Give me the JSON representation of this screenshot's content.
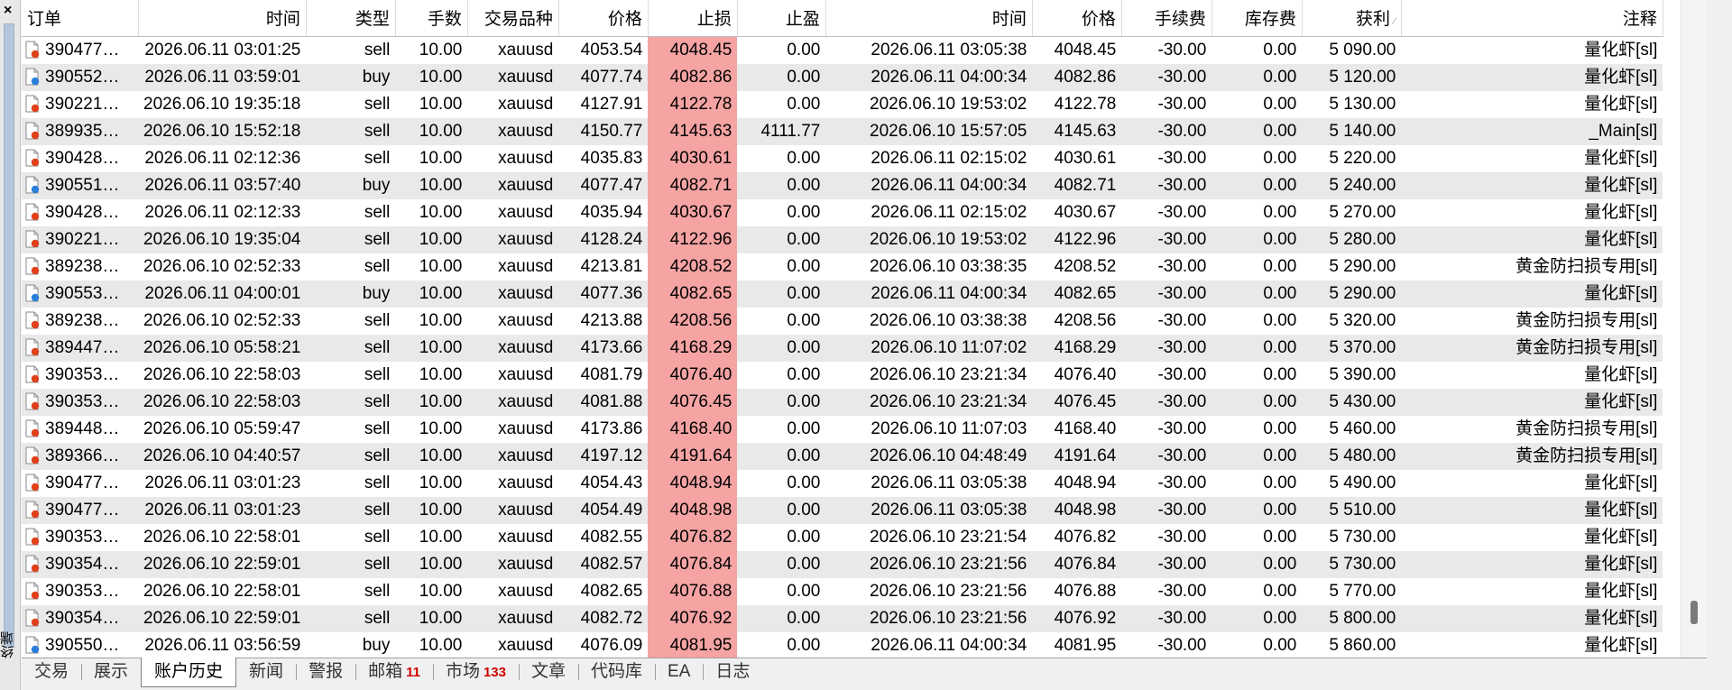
{
  "sidebar": {
    "close_glyph": "×",
    "vertical_label": "终端"
  },
  "columns": [
    "订单",
    "时间",
    "类型",
    "手数",
    "交易品种",
    "价格",
    "止损",
    "止盈",
    "时间",
    "价格",
    "手续费",
    "库存费",
    "获利",
    "注释"
  ],
  "sort_indicator": "⁄",
  "rows": [
    {
      "order": "390477…",
      "open_time": "2026.06.11 03:01:25",
      "type": "sell",
      "lots": "10.00",
      "symbol": "xauusd",
      "price": "4053.54",
      "sl": "4048.45",
      "tp": "0.00",
      "close_time": "2026.06.11 03:05:38",
      "close_price": "4048.45",
      "commission": "-30.00",
      "swap": "0.00",
      "profit": "5 090.00",
      "comment": "量化虾[sl]",
      "icon": "sell-order-icon"
    },
    {
      "order": "390552…",
      "open_time": "2026.06.11 03:59:01",
      "type": "buy",
      "lots": "10.00",
      "symbol": "xauusd",
      "price": "4077.74",
      "sl": "4082.86",
      "tp": "0.00",
      "close_time": "2026.06.11 04:00:34",
      "close_price": "4082.86",
      "commission": "-30.00",
      "swap": "0.00",
      "profit": "5 120.00",
      "comment": "量化虾[sl]",
      "icon": "buy-order-icon"
    },
    {
      "order": "390221…",
      "open_time": "2026.06.10 19:35:18",
      "type": "sell",
      "lots": "10.00",
      "symbol": "xauusd",
      "price": "4127.91",
      "sl": "4122.78",
      "tp": "0.00",
      "close_time": "2026.06.10 19:53:02",
      "close_price": "4122.78",
      "commission": "-30.00",
      "swap": "0.00",
      "profit": "5 130.00",
      "comment": "量化虾[sl]",
      "icon": "sell-order-icon"
    },
    {
      "order": "389935…",
      "open_time": "2026.06.10 15:52:18",
      "type": "sell",
      "lots": "10.00",
      "symbol": "xauusd",
      "price": "4150.77",
      "sl": "4145.63",
      "tp": "4111.77",
      "close_time": "2026.06.10 15:57:05",
      "close_price": "4145.63",
      "commission": "-30.00",
      "swap": "0.00",
      "profit": "5 140.00",
      "comment": "_Main[sl]",
      "icon": "sell-order-icon"
    },
    {
      "order": "390428…",
      "open_time": "2026.06.11 02:12:36",
      "type": "sell",
      "lots": "10.00",
      "symbol": "xauusd",
      "price": "4035.83",
      "sl": "4030.61",
      "tp": "0.00",
      "close_time": "2026.06.11 02:15:02",
      "close_price": "4030.61",
      "commission": "-30.00",
      "swap": "0.00",
      "profit": "5 220.00",
      "comment": "量化虾[sl]",
      "icon": "sell-order-icon"
    },
    {
      "order": "390551…",
      "open_time": "2026.06.11 03:57:40",
      "type": "buy",
      "lots": "10.00",
      "symbol": "xauusd",
      "price": "4077.47",
      "sl": "4082.71",
      "tp": "0.00",
      "close_time": "2026.06.11 04:00:34",
      "close_price": "4082.71",
      "commission": "-30.00",
      "swap": "0.00",
      "profit": "5 240.00",
      "comment": "量化虾[sl]",
      "icon": "buy-order-icon"
    },
    {
      "order": "390428…",
      "open_time": "2026.06.11 02:12:33",
      "type": "sell",
      "lots": "10.00",
      "symbol": "xauusd",
      "price": "4035.94",
      "sl": "4030.67",
      "tp": "0.00",
      "close_time": "2026.06.11 02:15:02",
      "close_price": "4030.67",
      "commission": "-30.00",
      "swap": "0.00",
      "profit": "5 270.00",
      "comment": "量化虾[sl]",
      "icon": "sell-order-icon"
    },
    {
      "order": "390221…",
      "open_time": "2026.06.10 19:35:04",
      "type": "sell",
      "lots": "10.00",
      "symbol": "xauusd",
      "price": "4128.24",
      "sl": "4122.96",
      "tp": "0.00",
      "close_time": "2026.06.10 19:53:02",
      "close_price": "4122.96",
      "commission": "-30.00",
      "swap": "0.00",
      "profit": "5 280.00",
      "comment": "量化虾[sl]",
      "icon": "sell-order-icon"
    },
    {
      "order": "389238…",
      "open_time": "2026.06.10 02:52:33",
      "type": "sell",
      "lots": "10.00",
      "symbol": "xauusd",
      "price": "4213.81",
      "sl": "4208.52",
      "tp": "0.00",
      "close_time": "2026.06.10 03:38:35",
      "close_price": "4208.52",
      "commission": "-30.00",
      "swap": "0.00",
      "profit": "5 290.00",
      "comment": "黄金防扫损专用[sl]",
      "icon": "sell-order-icon"
    },
    {
      "order": "390553…",
      "open_time": "2026.06.11 04:00:01",
      "type": "buy",
      "lots": "10.00",
      "symbol": "xauusd",
      "price": "4077.36",
      "sl": "4082.65",
      "tp": "0.00",
      "close_time": "2026.06.11 04:00:34",
      "close_price": "4082.65",
      "commission": "-30.00",
      "swap": "0.00",
      "profit": "5 290.00",
      "comment": "量化虾[sl]",
      "icon": "buy-order-icon"
    },
    {
      "order": "389238…",
      "open_time": "2026.06.10 02:52:33",
      "type": "sell",
      "lots": "10.00",
      "symbol": "xauusd",
      "price": "4213.88",
      "sl": "4208.56",
      "tp": "0.00",
      "close_time": "2026.06.10 03:38:38",
      "close_price": "4208.56",
      "commission": "-30.00",
      "swap": "0.00",
      "profit": "5 320.00",
      "comment": "黄金防扫损专用[sl]",
      "icon": "sell-order-icon"
    },
    {
      "order": "389447…",
      "open_time": "2026.06.10 05:58:21",
      "type": "sell",
      "lots": "10.00",
      "symbol": "xauusd",
      "price": "4173.66",
      "sl": "4168.29",
      "tp": "0.00",
      "close_time": "2026.06.10 11:07:02",
      "close_price": "4168.29",
      "commission": "-30.00",
      "swap": "0.00",
      "profit": "5 370.00",
      "comment": "黄金防扫损专用[sl]",
      "icon": "sell-order-icon"
    },
    {
      "order": "390353…",
      "open_time": "2026.06.10 22:58:03",
      "type": "sell",
      "lots": "10.00",
      "symbol": "xauusd",
      "price": "4081.79",
      "sl": "4076.40",
      "tp": "0.00",
      "close_time": "2026.06.10 23:21:34",
      "close_price": "4076.40",
      "commission": "-30.00",
      "swap": "0.00",
      "profit": "5 390.00",
      "comment": "量化虾[sl]",
      "icon": "sell-order-icon"
    },
    {
      "order": "390353…",
      "open_time": "2026.06.10 22:58:03",
      "type": "sell",
      "lots": "10.00",
      "symbol": "xauusd",
      "price": "4081.88",
      "sl": "4076.45",
      "tp": "0.00",
      "close_time": "2026.06.10 23:21:34",
      "close_price": "4076.45",
      "commission": "-30.00",
      "swap": "0.00",
      "profit": "5 430.00",
      "comment": "量化虾[sl]",
      "icon": "sell-order-icon"
    },
    {
      "order": "389448…",
      "open_time": "2026.06.10 05:59:47",
      "type": "sell",
      "lots": "10.00",
      "symbol": "xauusd",
      "price": "4173.86",
      "sl": "4168.40",
      "tp": "0.00",
      "close_time": "2026.06.10 11:07:03",
      "close_price": "4168.40",
      "commission": "-30.00",
      "swap": "0.00",
      "profit": "5 460.00",
      "comment": "黄金防扫损专用[sl]",
      "icon": "sell-order-icon"
    },
    {
      "order": "389366…",
      "open_time": "2026.06.10 04:40:57",
      "type": "sell",
      "lots": "10.00",
      "symbol": "xauusd",
      "price": "4197.12",
      "sl": "4191.64",
      "tp": "0.00",
      "close_time": "2026.06.10 04:48:49",
      "close_price": "4191.64",
      "commission": "-30.00",
      "swap": "0.00",
      "profit": "5 480.00",
      "comment": "黄金防扫损专用[sl]",
      "icon": "sell-order-icon"
    },
    {
      "order": "390477…",
      "open_time": "2026.06.11 03:01:23",
      "type": "sell",
      "lots": "10.00",
      "symbol": "xauusd",
      "price": "4054.43",
      "sl": "4048.94",
      "tp": "0.00",
      "close_time": "2026.06.11 03:05:38",
      "close_price": "4048.94",
      "commission": "-30.00",
      "swap": "0.00",
      "profit": "5 490.00",
      "comment": "量化虾[sl]",
      "icon": "sell-order-icon"
    },
    {
      "order": "390477…",
      "open_time": "2026.06.11 03:01:23",
      "type": "sell",
      "lots": "10.00",
      "symbol": "xauusd",
      "price": "4054.49",
      "sl": "4048.98",
      "tp": "0.00",
      "close_time": "2026.06.11 03:05:38",
      "close_price": "4048.98",
      "commission": "-30.00",
      "swap": "0.00",
      "profit": "5 510.00",
      "comment": "量化虾[sl]",
      "icon": "sell-order-icon"
    },
    {
      "order": "390353…",
      "open_time": "2026.06.10 22:58:01",
      "type": "sell",
      "lots": "10.00",
      "symbol": "xauusd",
      "price": "4082.55",
      "sl": "4076.82",
      "tp": "0.00",
      "close_time": "2026.06.10 23:21:54",
      "close_price": "4076.82",
      "commission": "-30.00",
      "swap": "0.00",
      "profit": "5 730.00",
      "comment": "量化虾[sl]",
      "icon": "sell-order-icon"
    },
    {
      "order": "390354…",
      "open_time": "2026.06.10 22:59:01",
      "type": "sell",
      "lots": "10.00",
      "symbol": "xauusd",
      "price": "4082.57",
      "sl": "4076.84",
      "tp": "0.00",
      "close_time": "2026.06.10 23:21:56",
      "close_price": "4076.84",
      "commission": "-30.00",
      "swap": "0.00",
      "profit": "5 730.00",
      "comment": "量化虾[sl]",
      "icon": "sell-order-icon"
    },
    {
      "order": "390353…",
      "open_time": "2026.06.10 22:58:01",
      "type": "sell",
      "lots": "10.00",
      "symbol": "xauusd",
      "price": "4082.65",
      "sl": "4076.88",
      "tp": "0.00",
      "close_time": "2026.06.10 23:21:56",
      "close_price": "4076.88",
      "commission": "-30.00",
      "swap": "0.00",
      "profit": "5 770.00",
      "comment": "量化虾[sl]",
      "icon": "sell-order-icon"
    },
    {
      "order": "390354…",
      "open_time": "2026.06.10 22:59:01",
      "type": "sell",
      "lots": "10.00",
      "symbol": "xauusd",
      "price": "4082.72",
      "sl": "4076.92",
      "tp": "0.00",
      "close_time": "2026.06.10 23:21:56",
      "close_price": "4076.92",
      "commission": "-30.00",
      "swap": "0.00",
      "profit": "5 800.00",
      "comment": "量化虾[sl]",
      "icon": "sell-order-icon"
    },
    {
      "order": "390550…",
      "open_time": "2026.06.11 03:56:59",
      "type": "buy",
      "lots": "10.00",
      "symbol": "xauusd",
      "price": "4076.09",
      "sl": "4081.95",
      "tp": "0.00",
      "close_time": "2026.06.11 04:00:34",
      "close_price": "4081.95",
      "commission": "-30.00",
      "swap": "0.00",
      "profit": "5 860.00",
      "comment": "量化虾[sl]",
      "icon": "buy-order-icon"
    }
  ],
  "tabs": [
    {
      "label": "交易",
      "badge": ""
    },
    {
      "label": "展示",
      "badge": ""
    },
    {
      "label": "账户历史",
      "badge": "",
      "active": true
    },
    {
      "label": "新闻",
      "badge": ""
    },
    {
      "label": "警报",
      "badge": ""
    },
    {
      "label": "邮箱",
      "badge": "11"
    },
    {
      "label": "市场",
      "badge": "133"
    },
    {
      "label": "文章",
      "badge": ""
    },
    {
      "label": "代码库",
      "badge": ""
    },
    {
      "label": "EA",
      "badge": ""
    },
    {
      "label": "日志",
      "badge": ""
    }
  ],
  "colors": {
    "stop_loss_highlight": "#f5a3a3",
    "sell_dot": "#e0401a",
    "buy_dot": "#2a7fd8",
    "row_alt": "#e9e9e9"
  }
}
